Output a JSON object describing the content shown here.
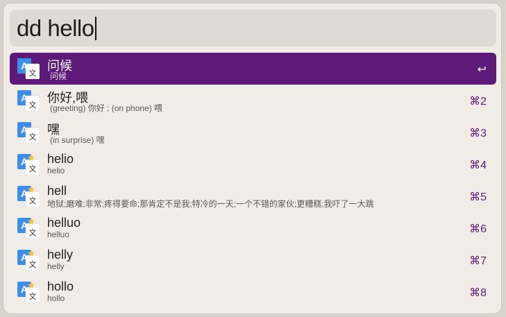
{
  "search": {
    "query": "dd hello"
  },
  "results": [
    {
      "title": "问候",
      "subtitle": "问候",
      "shortcut": "↩"
    },
    {
      "title": "你好,喂",
      "subtitle": "(greeting) 你好 ; (on phone) 喂",
      "shortcut": "⌘2"
    },
    {
      "title": "嘿",
      "subtitle": "(in surprise) 嘿",
      "shortcut": "⌘3"
    },
    {
      "title": "helio",
      "subtitle": "helio",
      "shortcut": "⌘4"
    },
    {
      "title": "hell",
      "subtitle": "地狱;磨难;非常;疼得要命;那肯定不是我;特冷的一天;一个不错的家伙;更糟糕;我吓了一大跳",
      "shortcut": "⌘5"
    },
    {
      "title": "helluo",
      "subtitle": "helluo",
      "shortcut": "⌘6"
    },
    {
      "title": "helly",
      "subtitle": "helly",
      "shortcut": "⌘7"
    },
    {
      "title": "hollo",
      "subtitle": "hollo",
      "shortcut": "⌘8"
    }
  ],
  "icon": {
    "name": "translate-icon",
    "letter_a": "A",
    "letter_b": "文",
    "color_blue": "#3d8ee9",
    "color_white": "#ffffff",
    "color_star": "#f2c53d"
  },
  "accent": "#5e1a78"
}
